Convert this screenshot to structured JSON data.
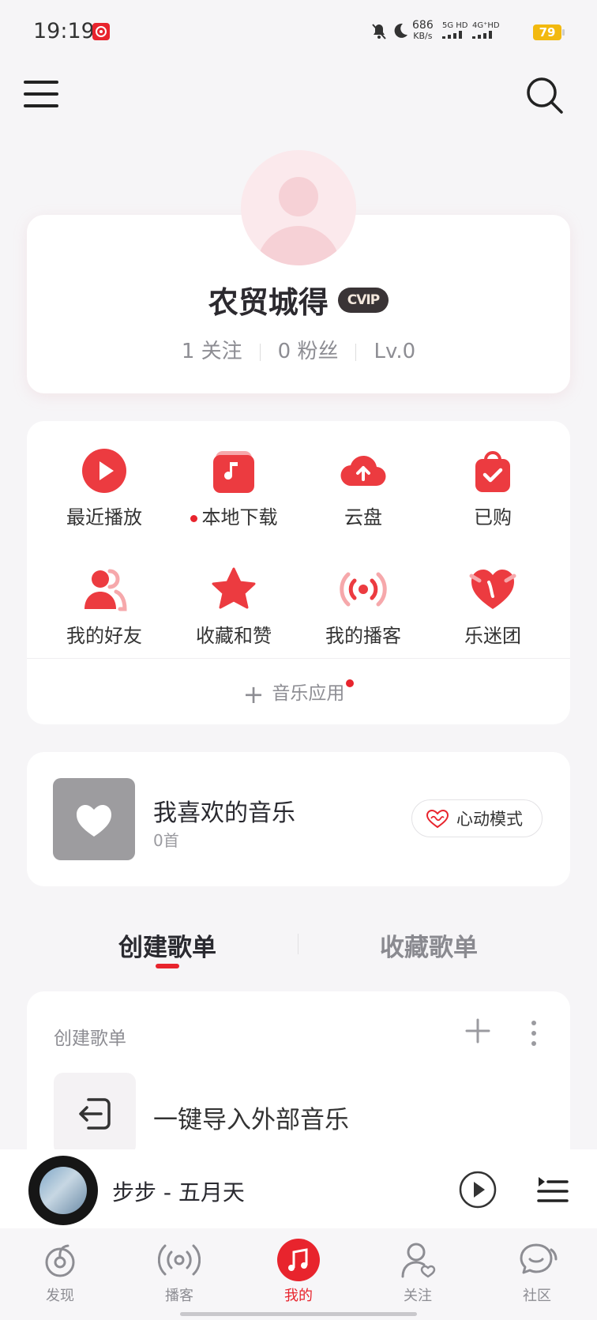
{
  "status_bar": {
    "time": "19:19",
    "speed_value": "686",
    "speed_unit": "KB/s",
    "net1": "5G HD",
    "net2": "4G⁺HD",
    "battery": "79"
  },
  "header": {
    "menu_icon": "hamburger-menu-icon",
    "search_icon": "search-icon"
  },
  "profile": {
    "name": "农贸城得",
    "vip_badge": "CVIP",
    "following": "1 关注",
    "followers": "0 粉丝",
    "level": "Lv.0"
  },
  "grid": {
    "items": [
      {
        "label": "最近播放",
        "icon": "play-circle-icon"
      },
      {
        "label": "本地下载",
        "icon": "music-note-icon",
        "dot": true
      },
      {
        "label": "云盘",
        "icon": "cloud-upload-icon"
      },
      {
        "label": "已购",
        "icon": "shopping-bag-check-icon"
      },
      {
        "label": "我的好友",
        "icon": "friends-icon"
      },
      {
        "label": "收藏和赞",
        "icon": "star-icon"
      },
      {
        "label": "我的播客",
        "icon": "podcast-broadcast-icon"
      },
      {
        "label": "乐迷团",
        "icon": "heart-fan-icon"
      }
    ],
    "music_app": "音乐应用"
  },
  "liked": {
    "title": "我喜欢的音乐",
    "count": "0首",
    "heart_mode": "心动模式"
  },
  "tabs": {
    "active": "创建歌单",
    "inactive": "收藏歌单"
  },
  "playlist_section": {
    "header": "创建歌单",
    "import_text": "一键导入外部音乐"
  },
  "player": {
    "song": "步步 - 五月天"
  },
  "nav": {
    "items": [
      {
        "label": "发现",
        "icon": "discover-icon"
      },
      {
        "label": "播客",
        "icon": "podcast-icon"
      },
      {
        "label": "我的",
        "icon": "music-notes-icon",
        "active": true
      },
      {
        "label": "关注",
        "icon": "follow-user-icon"
      },
      {
        "label": "社区",
        "icon": "community-chat-icon"
      }
    ]
  },
  "colors": {
    "accent": "#e8242d",
    "background": "#f6f5f7",
    "card": "#ffffff",
    "muted_text": "#8d8d93"
  }
}
